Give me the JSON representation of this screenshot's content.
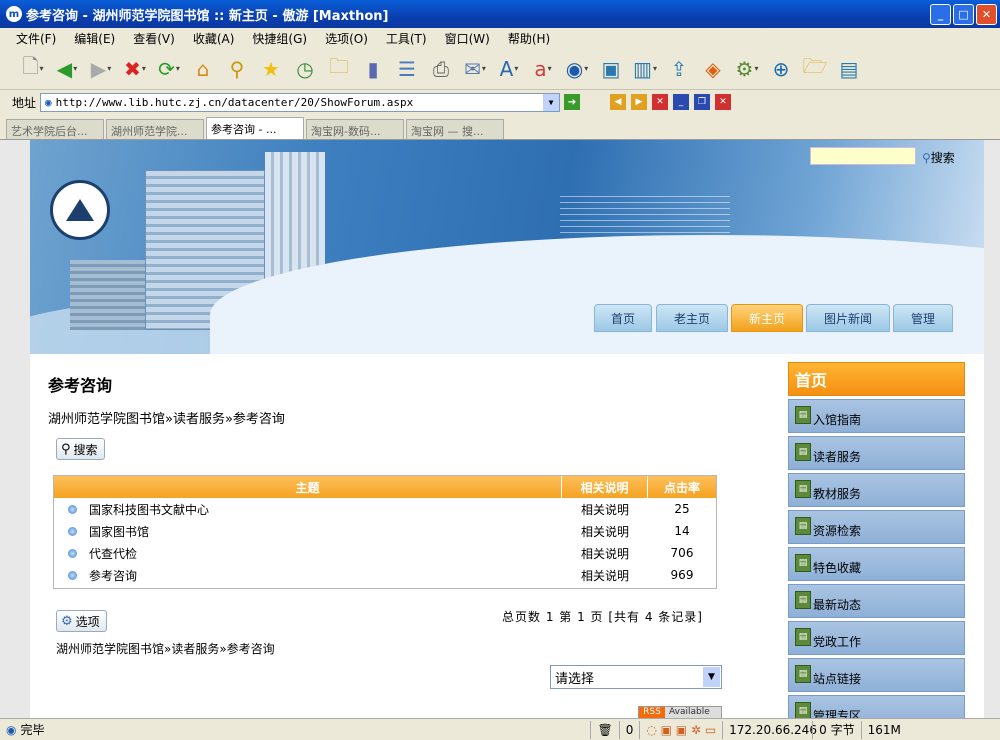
{
  "window": {
    "title": "参考咨询 - 湖州师范学院图书馆 :: 新主页 - 傲游 [Maxthon]",
    "app_icon": "m"
  },
  "menu": [
    "文件(F)",
    "编辑(E)",
    "查看(V)",
    "收藏(A)",
    "快捷组(G)",
    "选项(O)",
    "工具(T)",
    "窗口(W)",
    "帮助(H)"
  ],
  "address": {
    "label": "地址",
    "url": "http://www.lib.hutc.zj.cn/datacenter/20/ShowForum.aspx"
  },
  "tabs": [
    "艺术学院后台...",
    "湖州师范学院...",
    "参考咨询 - ...",
    "淘宝网-数码...",
    "淘宝网 — 搜..."
  ],
  "site": {
    "search_link": "搜索",
    "nav": [
      "首页",
      "老主页",
      "新主页",
      "图片新闻",
      "管理"
    ],
    "page_title": "参考咨询",
    "breadcrumb": "湖州师范学院图书馆»读者服务»参考咨询",
    "search_button": "搜索",
    "table_headers": [
      "主题",
      "相关说明",
      "点击率"
    ],
    "rows": [
      {
        "topic": "国家科技图书文献中心",
        "note": "相关说明",
        "clicks": "25"
      },
      {
        "topic": "国家图书馆",
        "note": "相关说明",
        "clicks": "14"
      },
      {
        "topic": "代查代检",
        "note": "相关说明",
        "clicks": "706"
      },
      {
        "topic": "参考咨询",
        "note": "相关说明",
        "clicks": "969"
      }
    ],
    "pager": "总页数 1 第 1 页 [共有 4 条记录]",
    "options_button": "选项",
    "breadcrumb2": "湖州师范学院图书馆»读者服务»参考咨询",
    "select_value": "请选择",
    "rss_label": "RSS",
    "rss_available": "Available",
    "sidebar_head": "首页",
    "sidebar_items": [
      "入馆指南",
      "读者服务",
      "教材服务",
      "资源检索",
      "特色收藏",
      "最新动态",
      "党政工作",
      "站点链接",
      "管理专区"
    ]
  },
  "status": {
    "text": "完毕",
    "count": "0",
    "ip": "172.20.66.246",
    "bytes": "0 字节",
    "mem": "161M"
  }
}
